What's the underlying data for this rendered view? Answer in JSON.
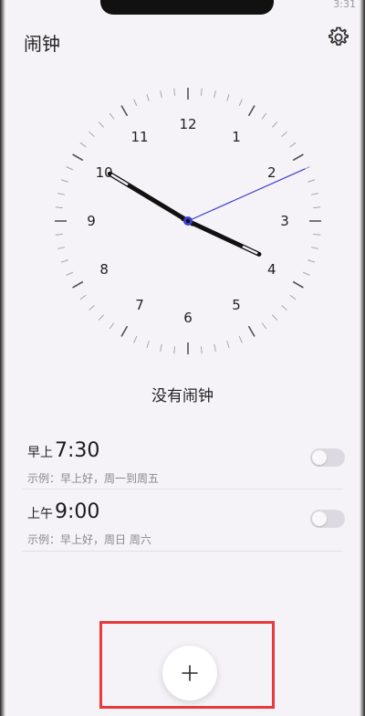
{
  "status_bar": {
    "left": "",
    "time": "3:31"
  },
  "header": {
    "title": "闹钟",
    "settings_icon": "gear-icon"
  },
  "clock": {
    "numerals": [
      "12",
      "1",
      "2",
      "3",
      "4",
      "5",
      "6",
      "7",
      "8",
      "9",
      "10",
      "11"
    ],
    "time_shown": {
      "hour": 3,
      "minute": 50,
      "second": 11
    },
    "second_hand_color": "#3b3fcf",
    "hand_color": "#111111"
  },
  "empty_state": "没有闹钟",
  "alarms": [
    {
      "prefix": "早上",
      "time": "7:30",
      "example": "示例：早上好，周一到周五",
      "enabled": false
    },
    {
      "prefix": "上午",
      "time": "9:00",
      "example": "示例：早上好，周日 周六",
      "enabled": false
    }
  ],
  "fab": {
    "icon": "plus-icon",
    "highlight_color": "#e83a3a"
  }
}
